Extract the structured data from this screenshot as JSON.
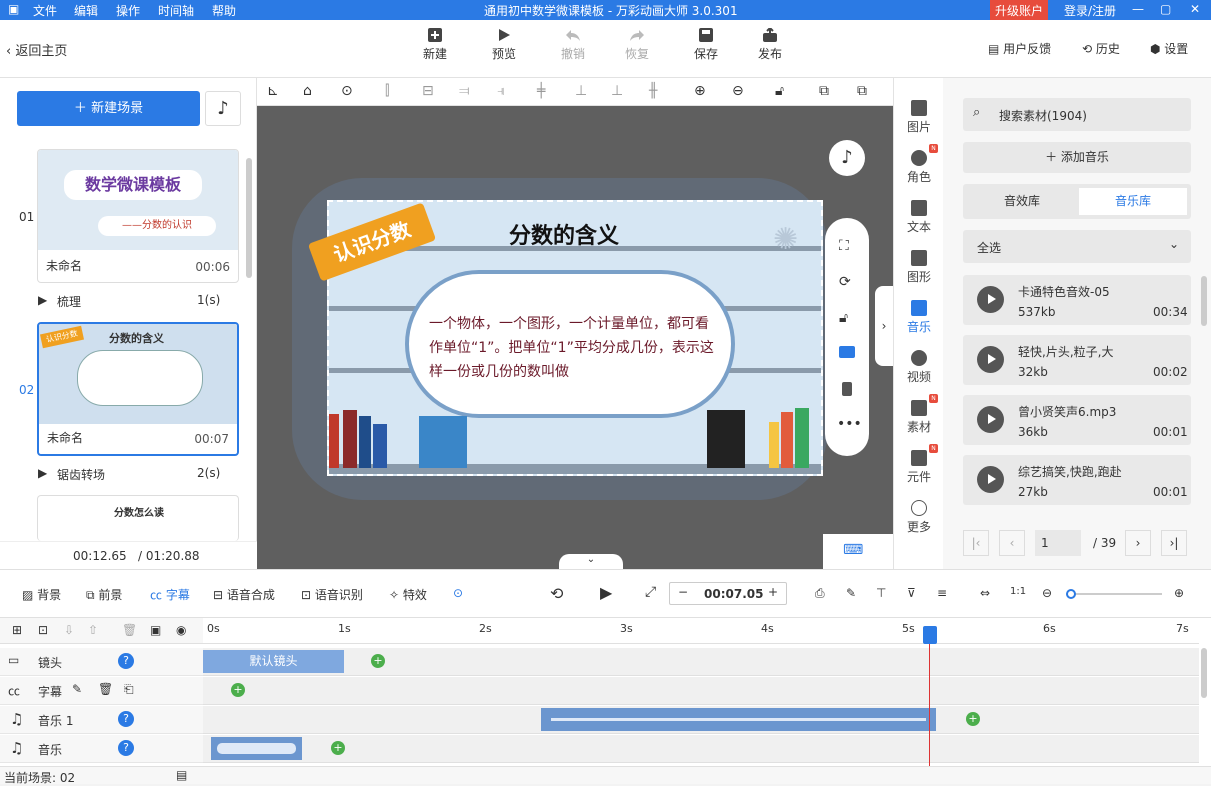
{
  "app": {
    "title": "通用初中数学微课模板 - 万彩动画大师 3.0.301",
    "upgrade": "升级账户",
    "login": "登录/注册"
  },
  "menu": [
    "文件",
    "编辑",
    "操作",
    "时间轴",
    "帮助"
  ],
  "toolbar": {
    "back": "返回主页",
    "new": "新建",
    "preview": "预览",
    "undo": "撤销",
    "redo": "恢复",
    "save": "保存",
    "publish": "发布",
    "feedback": "用户反馈",
    "history": "历史",
    "settings": "设置"
  },
  "left": {
    "new_scene": "新建场景",
    "scenes": [
      {
        "num": "01",
        "name": "未命名",
        "dur": "00:06",
        "trans": "梳理",
        "trans_dur": "1(s)",
        "title1": "数学微课模板",
        "title2": "——分数的认识"
      },
      {
        "num": "02",
        "name": "未命名",
        "dur": "00:07",
        "trans": "锯齿转场",
        "trans_dur": "2(s)",
        "title1": "分数的含义",
        "tag": "认识分数"
      },
      {
        "title1": "分数怎么读"
      }
    ],
    "time_current": "00:12.65",
    "time_total": "/ 01:20.88"
  },
  "stage": {
    "tag": "认识分数",
    "heading": "分数的含义",
    "body": "一个物体，一个图形，一个计量单位，都可看作单位“1”。把单位“1”平均分成几份，表示这样一份或几份的数叫做"
  },
  "right_icons": [
    "图片",
    "角色",
    "文本",
    "图形",
    "音乐",
    "视频",
    "素材",
    "元件",
    "更多"
  ],
  "library": {
    "search": "搜索素材(1904)",
    "add_music": "添加音乐",
    "tab_sfx": "音效库",
    "tab_music": "音乐库",
    "filter": "全选",
    "items": [
      {
        "name": "卡通特色音效-05",
        "size": "537kb",
        "dur": "00:34"
      },
      {
        "name": "轻快,片头,粒子,大",
        "size": "32kb",
        "dur": "00:02"
      },
      {
        "name": "曾小贤笑声6.mp3",
        "size": "36kb",
        "dur": "00:01"
      },
      {
        "name": "综艺搞笑,快跑,跑赴",
        "size": "27kb",
        "dur": "00:01"
      }
    ],
    "page": "1",
    "pages": "/ 39"
  },
  "timeline": {
    "bg": "背景",
    "fg": "前景",
    "subtitle": "字幕",
    "tts": "语音合成",
    "asr": "语音识别",
    "fx": "特效",
    "time": "00:07.05",
    "ticks": [
      "0s",
      "1s",
      "2s",
      "3s",
      "4s",
      "5s",
      "6s",
      "7s"
    ],
    "tracks": [
      "镜头",
      "字幕",
      "音乐 1",
      "音乐"
    ],
    "cam_clip": "默认镜头",
    "current_scene": "当前场景: 02"
  }
}
